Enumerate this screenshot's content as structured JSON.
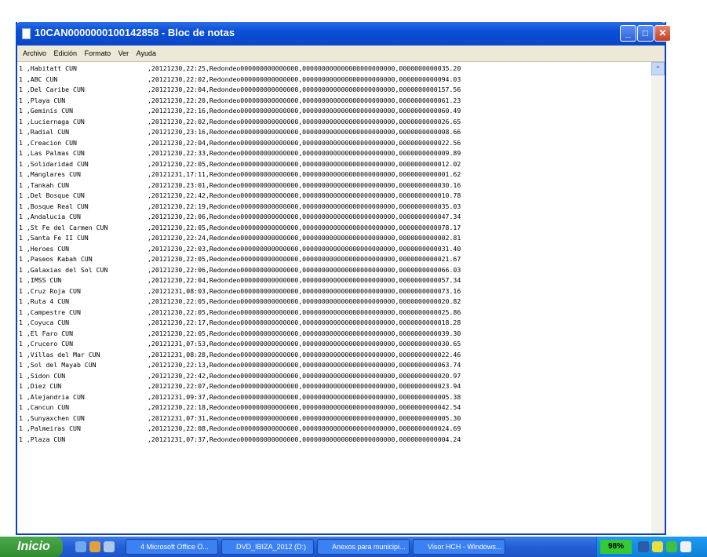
{
  "window": {
    "title": "10CAN0000000100142858 - Bloc de notas",
    "controls": {
      "minimize": "_",
      "maximize": "□",
      "close": "✕"
    }
  },
  "menu": [
    "Archivo",
    "Edición",
    "Formato",
    "Ver",
    "Ayuda"
  ],
  "rows": [
    {
      "name": "1 ,Habitatt CUN",
      "data": ",20121230,22:25,Redondeo000000000000000,000000000000000000000000,0000000000035.20"
    },
    {
      "name": "1 ,ABC CUN",
      "data": ",20121230,22:02,Redondeo000000000000000,000000000000000000000000,0000000000094.03"
    },
    {
      "name": "1 ,Del Caribe CUN",
      "data": ",20121230,22:04,Redondeo000000000000000,000000000000000000000000,0000000000157.56"
    },
    {
      "name": "1 ,Playa CUN",
      "data": ",20121230,22:20,Redondeo000000000000000,000000000000000000000000,0000000000061.23"
    },
    {
      "name": "1 ,Geminis CUN",
      "data": ",20121230,22:16,Redondeo000000000000000,000000000000000000000000,0000000000060.49"
    },
    {
      "name": "1 ,Luciernaga CUN",
      "data": ",20121230,22:02,Redondeo000000000000000,000000000000000000000000,0000000000026.65"
    },
    {
      "name": "1 ,Radial CUN",
      "data": ",20121230,23:16,Redondeo000000000000000,000000000000000000000000,0000000000008.66"
    },
    {
      "name": "1 ,Creacion CUN",
      "data": ",20121230,22:04,Redondeo000000000000000,000000000000000000000000,0000000000022.56"
    },
    {
      "name": "1 ,Las Palmas CUN",
      "data": ",20121230,22:33,Redondeo000000000000000,000000000000000000000000,0000000000009.89"
    },
    {
      "name": "1 ,Solidaridad CUN",
      "data": ",20121230,22:05,Redondeo000000000000000,000000000000000000000000,0000000000012.02"
    },
    {
      "name": "1 ,Manglares CUN",
      "data": ",20121231,17:11,Redondeo000000000000000,000000000000000000000000,0000000000001.62"
    },
    {
      "name": "1 ,Tankah CUN",
      "data": ",20121230,23:01,Redondeo000000000000000,000000000000000000000000,0000000000030.16"
    },
    {
      "name": "1 ,Del Bosque CUN",
      "data": ",20121230,22:42,Redondeo000000000000000,000000000000000000000000,0000000000010.78"
    },
    {
      "name": "1 ,Bosque Real CUN",
      "data": ",20121230,22:19,Redondeo000000000000000,000000000000000000000000,0000000000035.03"
    },
    {
      "name": "1 ,Andalucia CUN",
      "data": ",20121230,22:06,Redondeo000000000000000,000000000000000000000000,0000000000047.34"
    },
    {
      "name": "1 ,St Fe del Carmen CUN",
      "data": ",20121230,22:05,Redondeo000000000000000,000000000000000000000000,0000000000078.17"
    },
    {
      "name": "1 ,Santa Fe II CUN",
      "data": ",20121230,22:24,Redondeo000000000000000,000000000000000000000000,0000000000002.81"
    },
    {
      "name": "1 ,Heroes CUN",
      "data": ",20121230,22:03,Redondeo000000000000000,000000000000000000000000,0000000000031.40"
    },
    {
      "name": "1 ,Paseos Kabah CUN",
      "data": ",20121230,22:05,Redondeo000000000000000,000000000000000000000000,0000000000021.67"
    },
    {
      "name": "1 ,Galaxias del Sol CUN",
      "data": ",20121230,22:06,Redondeo000000000000000,000000000000000000000000,0000000000066.03"
    },
    {
      "name": "1 ,IMSS CUN",
      "data": ",20121230,22:04,Redondeo000000000000000,000000000000000000000000,0000000000057.34"
    },
    {
      "name": "1 ,Cruz Roja CUN",
      "data": ",20121231,08:03,Redondeo000000000000000,000000000000000000000000,0000000000073.16"
    },
    {
      "name": "1 ,Ruta 4 CUN",
      "data": ",20121230,22:05,Redondeo000000000000000,000000000000000000000000,0000000000020.82"
    },
    {
      "name": "1 ,Campestre CUN",
      "data": ",20121230,22:05,Redondeo000000000000000,000000000000000000000000,0000000000025.86"
    },
    {
      "name": "1 ,Coyuca CUN",
      "data": ",20121230,22:17,Redondeo000000000000000,000000000000000000000000,0000000000018.28"
    },
    {
      "name": "1 ,El Faro CUN",
      "data": ",20121230,22:05,Redondeo000000000000000,000000000000000000000000,0000000000039.30"
    },
    {
      "name": "1 ,Crucero CUN",
      "data": ",20121231,07:53,Redondeo000000000000000,000000000000000000000000,0000000000030.65"
    },
    {
      "name": "1 ,Villas del Mar CUN",
      "data": ",20121231,08:28,Redondeo000000000000000,000000000000000000000000,0000000000022.46"
    },
    {
      "name": "1 ,Sol del Mayab CUN",
      "data": ",20121230,22:13,Redondeo000000000000000,000000000000000000000000,0000000000063.74"
    },
    {
      "name": "1 ,Sidon CUN",
      "data": ",20121230,22:42,Redondeo000000000000000,000000000000000000000000,0000000000020.97"
    },
    {
      "name": "1 ,Diez CUN",
      "data": ",20121230,22:07,Redondeo000000000000000,000000000000000000000000,0000000000023.94"
    },
    {
      "name": "1 ,Alejandria CUN",
      "data": ",20121231,09:37,Redondeo000000000000000,000000000000000000000000,0000000000005.38"
    },
    {
      "name": "1 ,Cancun CUN",
      "data": ",20121230,22:18,Redondeo000000000000000,000000000000000000000000,0000000000042.54"
    },
    {
      "name": "1 ,Sunyaxchen CUN",
      "data": ",20121231,07:31,Redondeo000000000000000,000000000000000000000000,0000000000005.30"
    },
    {
      "name": "1 ,Palmeiras CUN",
      "data": ",20121230,22:08,Redondeo000000000000000,000000000000000000000000,0000000000024.69"
    },
    {
      "name": "1 ,Plaza CUN",
      "data": ",20121231,07:37,Redondeo000000000000000,000000000000000000000000,0000000000004.24"
    }
  ],
  "scrollbar": {
    "up_arrow": "^"
  },
  "taskbar": {
    "start_label": "Inicio",
    "items": [
      "4 Microsoft Office O...",
      "DVD_IBIZA_2012 (D:)",
      "Anexos para municipi...",
      "Visor HCH - Windows..."
    ],
    "battery_percent": "98%"
  },
  "colors": {
    "titlebar": "#0a4fd8",
    "taskbar": "#245ed6",
    "start": "#2f8c2f",
    "tray": "#0f7fd8"
  }
}
